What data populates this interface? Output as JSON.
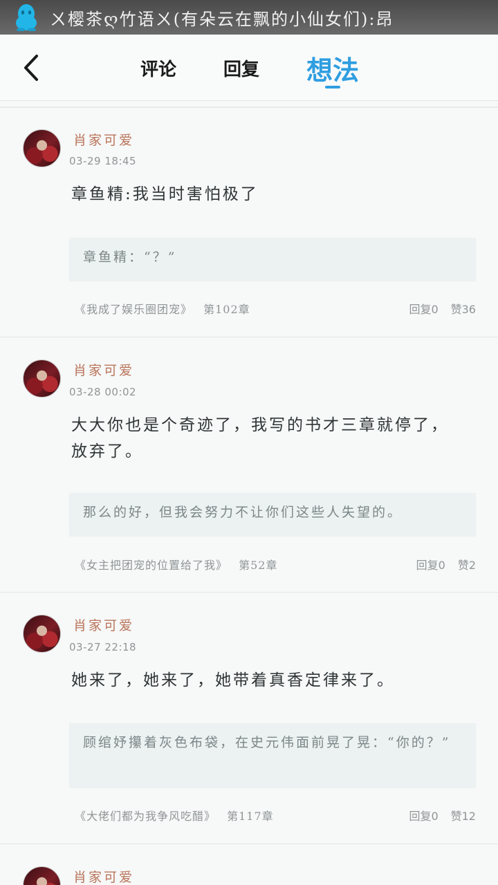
{
  "notification": {
    "app_icon": "qq-penguin-icon",
    "text": "ㄨ樱茶ღ竹语ㄨ(有朵云在飘的小仙女们):昂"
  },
  "header": {
    "back_icon": "chevron-left-icon",
    "tabs": [
      {
        "label": "评论",
        "active": false
      },
      {
        "label": "回复",
        "active": false
      },
      {
        "label": "想法",
        "active": true
      }
    ],
    "accent_color": "#2f9ee0"
  },
  "posts": [
    {
      "username": "肖家可爱",
      "timestamp": "03-29 18:45",
      "content": "章鱼精:我当时害怕极了",
      "quote": "章鱼精：“？”",
      "book": "《我成了娱乐圈团宠》",
      "chapter": "第102章",
      "replies": "回复0",
      "likes": "赞36"
    },
    {
      "username": "肖家可爱",
      "timestamp": "03-28 00:02",
      "content": "大大你也是个奇迹了，我写的书才三章就停了，放弃了。",
      "quote": "那么的好，但我会努力不让你们这些人失望的。",
      "book": "《女主把团宠的位置给了我》",
      "chapter": "第52章",
      "replies": "回复0",
      "likes": "赞2"
    },
    {
      "username": "肖家可爱",
      "timestamp": "03-27 22:18",
      "content": "她来了，她来了，她带着真香定律来了。",
      "quote": "顾绾妤攥着灰色布袋，在史元伟面前晃了晃：“你的？”",
      "book": "《大佬们都为我争风吃醋》",
      "chapter": "第117章",
      "replies": "回复0",
      "likes": "赞12"
    },
    {
      "username": "肖家可爱"
    }
  ]
}
